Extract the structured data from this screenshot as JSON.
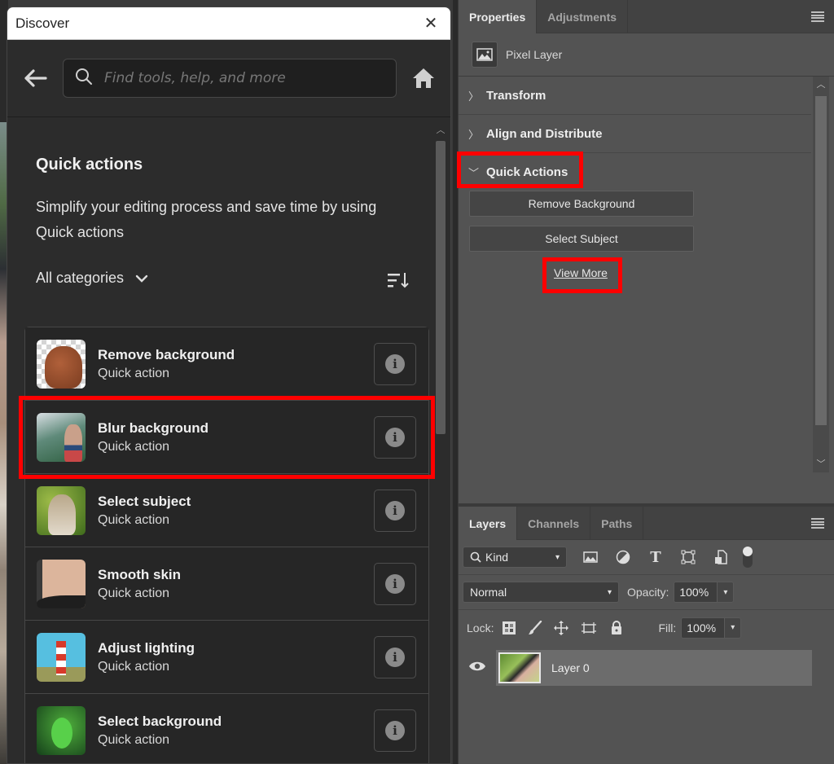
{
  "discover": {
    "title": "Discover",
    "search_placeholder": "Find tools, help, and more",
    "heading": "Quick actions",
    "description": "Simplify your editing process and save time by using Quick actions",
    "category_filter": "All categories",
    "items": [
      {
        "name": "Remove background",
        "sub": "Quick action",
        "thumb": "dog-on-transparent"
      },
      {
        "name": "Blur background",
        "sub": "Quick action",
        "thumb": "woman-profile-blurred"
      },
      {
        "name": "Select subject",
        "sub": "Quick action",
        "thumb": "cat-selected"
      },
      {
        "name": "Smooth skin",
        "sub": "Quick action",
        "thumb": "face-closeup"
      },
      {
        "name": "Adjust lighting",
        "sub": "Quick action",
        "thumb": "lighthouse"
      },
      {
        "name": "Select background",
        "sub": "Quick action",
        "thumb": "green-parrot"
      }
    ],
    "highlighted_item": "Blur background"
  },
  "properties": {
    "tabs": [
      "Properties",
      "Adjustments"
    ],
    "active_tab": "Properties",
    "layer_type": "Pixel Layer",
    "sections": [
      {
        "label": "Transform",
        "expanded": false
      },
      {
        "label": "Align and Distribute",
        "expanded": false
      },
      {
        "label": "Quick Actions",
        "expanded": true
      }
    ],
    "quick_action_buttons": [
      "Remove Background",
      "Select Subject"
    ],
    "view_more_link": "View More"
  },
  "layers": {
    "tabs": [
      "Layers",
      "Channels",
      "Paths"
    ],
    "active_tab": "Layers",
    "filter_kind": "Kind",
    "blend_mode": "Normal",
    "opacity_label": "Opacity:",
    "opacity_value": "100%",
    "lock_label": "Lock:",
    "fill_label": "Fill:",
    "fill_value": "100%",
    "layer_list": [
      {
        "name": "Layer 0",
        "visible": true
      }
    ]
  },
  "colors": {
    "highlight": "#ff0000",
    "discover_bg": "#2c2c2c",
    "panel_bg": "#535353"
  }
}
